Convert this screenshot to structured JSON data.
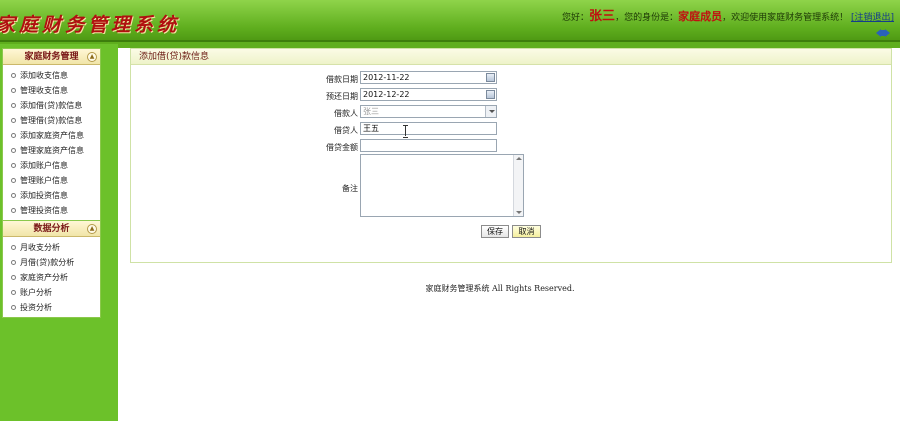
{
  "header": {
    "logo": "家庭财务管理系统",
    "welcome_prefix": "您好：",
    "user_name": "张三",
    "role_prefix": "，您的身份是：",
    "role": "家庭成员",
    "welcome_suffix": "，欢迎使用家庭财务管理系统！",
    "logout": "[注销退出]"
  },
  "sidebar": {
    "panels": [
      {
        "title": "家庭财务管理",
        "items": [
          "添加收支信息",
          "管理收支信息",
          "添加借(贷)款信息",
          "管理借(贷)款信息",
          "添加家庭资产信息",
          "管理家庭资产信息",
          "添加账户信息",
          "管理账户信息",
          "添加投资信息",
          "管理投资信息"
        ]
      },
      {
        "title": "数据分析",
        "items": [
          "月收支分析",
          "月借(贷)款分析",
          "家庭资产分析",
          "账户分析",
          "投资分析"
        ]
      }
    ]
  },
  "form": {
    "title": "添加借(贷)款信息",
    "loan_date_label": "借款日期",
    "loan_date": "2012-11-22",
    "due_date_label": "预还日期",
    "due_date": "2012-12-22",
    "borrower_label": "借款人",
    "borrower": "张三",
    "lender_label": "借贷人",
    "lender": "王五",
    "amount_label": "借贷金额",
    "amount": "",
    "note_label": "备注",
    "save": "保存",
    "cancel": "取消"
  },
  "footer": {
    "text": "家庭财务管理系统 All Rights Reserved."
  },
  "colors": {
    "header_green": "#5fae1e",
    "sidebar_green": "#6cc12a",
    "logo_red": "#b01010",
    "panel_title": "#7a1818"
  }
}
